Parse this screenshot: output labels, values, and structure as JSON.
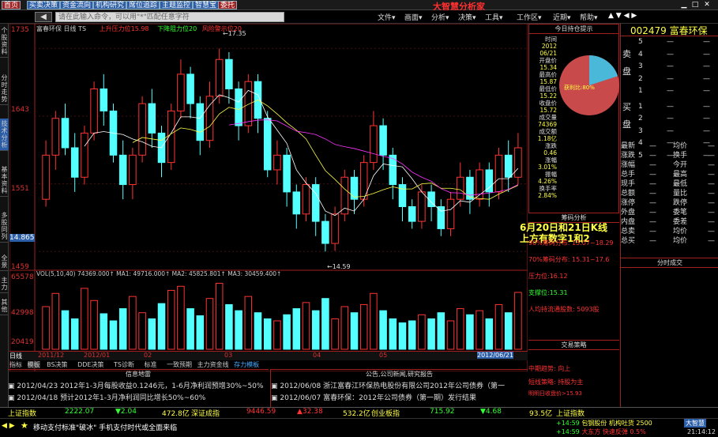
{
  "toolbar": {
    "buttons": [
      {
        "label": "首页"
      },
      {
        "label": "买卖决策"
      },
      {
        "label": "资金流向"
      },
      {
        "label": "机构研究"
      },
      {
        "label": "席位追踪"
      },
      {
        "label": "主题监控"
      },
      {
        "label": "智慧宝"
      },
      {
        "label": "委托"
      }
    ],
    "app_title": "大智慧分析家"
  },
  "menubar": {
    "command_placeholder": "请在此输入命令，可以用\"*\"匹配任意字符",
    "items": [
      "文件▾",
      "画面▾",
      "分析▾",
      "决策▾",
      "工具▾",
      "工作区▾",
      "近期▾",
      "帮助▾"
    ]
  },
  "left_tabs": [
    "个股资料",
    "分时走势",
    "技术分析",
    "基本资料",
    "多股同列",
    "全景",
    "主力",
    "其他"
  ],
  "chart": {
    "stock_label": "富春环保 日线 TS",
    "legend_up": "上升压力位15.98",
    "legend_down": "下降阻力位20",
    "legend_risk": "风险警示位20",
    "y_ticks": [
      "1735",
      "1643",
      "1551",
      "14.865",
      "1459"
    ],
    "high_mark": "17.35",
    "low_mark": "14.59",
    "annotation_line1": "6月20日和21日K线",
    "annotation_line2": "上方有数字1和2",
    "candles": [
      {
        "o": 15.3,
        "c": 15.9,
        "h": 16.1,
        "l": 15.2
      },
      {
        "o": 15.9,
        "c": 16.4,
        "h": 16.5,
        "l": 15.7
      },
      {
        "o": 16.4,
        "c": 16.0,
        "h": 16.6,
        "l": 15.9
      },
      {
        "o": 16.0,
        "c": 15.6,
        "h": 16.2,
        "l": 15.4
      },
      {
        "o": 15.6,
        "c": 16.2,
        "h": 16.3,
        "l": 15.5
      },
      {
        "o": 16.2,
        "c": 16.8,
        "h": 16.9,
        "l": 16.1
      },
      {
        "o": 16.8,
        "c": 16.5,
        "h": 17.0,
        "l": 16.3
      },
      {
        "o": 16.5,
        "c": 15.9,
        "h": 16.6,
        "l": 15.8
      },
      {
        "o": 15.9,
        "c": 15.5,
        "h": 16.1,
        "l": 15.3
      },
      {
        "o": 15.5,
        "c": 15.9,
        "h": 16.0,
        "l": 15.3
      },
      {
        "o": 15.9,
        "c": 16.6,
        "h": 16.7,
        "l": 15.8
      },
      {
        "o": 16.6,
        "c": 16.2,
        "h": 16.8,
        "l": 16.0
      },
      {
        "o": 16.2,
        "c": 15.8,
        "h": 16.3,
        "l": 15.6
      },
      {
        "o": 15.8,
        "c": 16.5,
        "h": 16.6,
        "l": 15.7
      },
      {
        "o": 16.5,
        "c": 17.0,
        "h": 17.2,
        "l": 16.4
      },
      {
        "o": 17.0,
        "c": 16.6,
        "h": 17.1,
        "l": 16.4
      },
      {
        "o": 16.6,
        "c": 16.1,
        "h": 16.7,
        "l": 15.9
      },
      {
        "o": 16.1,
        "c": 16.7,
        "h": 16.9,
        "l": 16.0
      },
      {
        "o": 16.7,
        "c": 17.2,
        "h": 17.35,
        "l": 16.6
      },
      {
        "o": 17.2,
        "c": 16.8,
        "h": 17.3,
        "l": 16.6
      },
      {
        "o": 16.8,
        "c": 16.3,
        "h": 16.9,
        "l": 16.1
      },
      {
        "o": 16.3,
        "c": 16.9,
        "h": 17.0,
        "l": 16.2
      },
      {
        "o": 16.9,
        "c": 16.4,
        "h": 17.0,
        "l": 16.2
      },
      {
        "o": 16.4,
        "c": 15.7,
        "h": 16.5,
        "l": 15.6
      },
      {
        "o": 15.7,
        "c": 15.9,
        "h": 16.1,
        "l": 15.5
      },
      {
        "o": 15.9,
        "c": 15.4,
        "h": 16.0,
        "l": 15.2
      },
      {
        "o": 15.4,
        "c": 15.1,
        "h": 15.5,
        "l": 14.9
      },
      {
        "o": 15.1,
        "c": 15.5,
        "h": 15.6,
        "l": 15.0
      },
      {
        "o": 15.5,
        "c": 15.0,
        "h": 15.6,
        "l": 14.8
      },
      {
        "o": 15.0,
        "c": 14.7,
        "h": 15.1,
        "l": 14.59
      },
      {
        "o": 14.7,
        "c": 15.1,
        "h": 15.2,
        "l": 14.6
      },
      {
        "o": 15.1,
        "c": 15.6,
        "h": 15.7,
        "l": 15.0
      },
      {
        "o": 15.6,
        "c": 15.3,
        "h": 15.7,
        "l": 15.1
      },
      {
        "o": 15.3,
        "c": 15.8,
        "h": 15.9,
        "l": 15.2
      },
      {
        "o": 15.8,
        "c": 16.3,
        "h": 16.5,
        "l": 15.7
      },
      {
        "o": 16.3,
        "c": 15.9,
        "h": 16.4,
        "l": 15.7
      },
      {
        "o": 15.9,
        "c": 15.5,
        "h": 16.0,
        "l": 15.3
      },
      {
        "o": 15.5,
        "c": 15.2,
        "h": 15.6,
        "l": 15.0
      },
      {
        "o": 15.2,
        "c": 15.0,
        "h": 15.3,
        "l": 14.9
      },
      {
        "o": 15.0,
        "c": 15.4,
        "h": 15.5,
        "l": 14.9
      },
      {
        "o": 15.4,
        "c": 15.2,
        "h": 15.5,
        "l": 15.0
      },
      {
        "o": 15.2,
        "c": 14.9,
        "h": 15.3,
        "l": 14.8
      },
      {
        "o": 14.9,
        "c": 15.3,
        "h": 15.4,
        "l": 14.8
      },
      {
        "o": 15.3,
        "c": 15.6,
        "h": 15.8,
        "l": 15.2
      },
      {
        "o": 15.6,
        "c": 15.3,
        "h": 15.7,
        "l": 15.1
      },
      {
        "o": 15.3,
        "c": 15.7,
        "h": 15.8,
        "l": 15.2
      },
      {
        "o": 15.7,
        "c": 15.4,
        "h": 15.8,
        "l": 15.2
      },
      {
        "o": 15.4,
        "c": 15.9,
        "h": 16.0,
        "l": 15.3
      },
      {
        "o": 15.9,
        "c": 15.6,
        "h": 16.1,
        "l": 15.4
      },
      {
        "o": 15.6,
        "c": 16.0,
        "h": 16.2,
        "l": 15.5
      }
    ]
  },
  "volume": {
    "legend": "VOL(5,10,40) 74369.000↑ MA1: 49716.000↑ MA2: 45825.801↑ MA3: 30459.400↑",
    "y_ticks": [
      "65578",
      "42998",
      "20419"
    ],
    "bars": [
      42,
      55,
      38,
      30,
      60,
      48,
      35,
      28,
      40,
      52,
      36,
      30,
      45,
      58,
      62,
      40,
      33,
      50,
      65,
      44,
      38,
      52,
      36,
      30,
      28,
      34,
      40,
      46,
      38,
      50,
      30,
      42,
      36,
      44,
      55,
      38,
      30,
      26,
      28,
      34,
      30,
      36,
      28,
      40,
      34,
      38,
      30,
      44,
      36,
      56
    ]
  },
  "date_axis": {
    "period_label": "日线",
    "ticks": [
      "2011/12",
      "2012/01",
      "02",
      "03",
      "04",
      "05",
      "2012/06/21"
    ]
  },
  "bottom_tabs": [
    "指标",
    "模板",
    "BS决策",
    "DDE决策",
    "TS诊断",
    "标准",
    "一致预期",
    "主力资金线",
    "存力模板"
  ],
  "news_left": {
    "title": "信息地雷",
    "items": [
      "2012/04/23 2012年1-3月每股收益0.1246元，1-6月净利润预增30%~50%",
      "2012/04/18 预计2012年1-3月净利润同比增长50%~60%"
    ]
  },
  "news_right": {
    "title": "公告,公司新闻,研究报告",
    "items": [
      "2012/06/08 浙江富春江环保热电股份有限公司2012年公司债券（第一",
      "2012/06/07 富春环保：2012年公司债券（第一期）发行结果"
    ]
  },
  "info_panel": {
    "title": "今日持仓提示",
    "rows": [
      {
        "label": "时间",
        "value": "2012 06/21"
      },
      {
        "label": "开盘价",
        "value": "15.34"
      },
      {
        "label": "最高价",
        "value": "15.87"
      },
      {
        "label": "最低价",
        "value": "15.22"
      },
      {
        "label": "收盘价",
        "value": "15.72"
      },
      {
        "label": "成交量",
        "value": "74369"
      },
      {
        "label": "成交额",
        "value": "1.18亿"
      },
      {
        "label": "涨跌",
        "value": "0.46"
      },
      {
        "label": "涨幅",
        "value": "3.01%"
      },
      {
        "label": "振幅",
        "value": "4.26%"
      },
      {
        "label": "换手率",
        "value": "2.84%"
      }
    ],
    "pie_label": "获利比:80%",
    "pie_fraction": 0.2
  },
  "chip_panel": {
    "title": "筹码分析",
    "lines": [
      "90%筹码分布: 15.07~18.29",
      "70%筹码分布: 15.31~17.6",
      "压力位:16.12",
      "支撑位:15.31",
      "人均持流通股数: 5093股"
    ]
  },
  "strategy_panel": {
    "title": "交易策略",
    "lines": [
      "中期趋势: 向上",
      "短线策略: 持股为主",
      "明明日收盘价>15.93"
    ]
  },
  "quote": {
    "code": "002479",
    "name": "富春环保",
    "sell_label": "卖盘",
    "buy_label": "买盘",
    "levels": [
      "5",
      "4",
      "3",
      "2",
      "1",
      "1",
      "2",
      "3",
      "4",
      "5"
    ],
    "fields": [
      {
        "l": "最新",
        "r": "均价"
      },
      {
        "l": "涨跌",
        "r": "换手"
      },
      {
        "l": "涨幅",
        "r": "今开"
      },
      {
        "l": "总手",
        "r": "最高"
      },
      {
        "l": "现手",
        "r": "最低"
      },
      {
        "l": "总额",
        "r": "量比"
      },
      {
        "l": "涨停",
        "r": "跌停"
      },
      {
        "l": "外盘",
        "r": "委笔"
      },
      {
        "l": "内盘",
        "r": "委差"
      },
      {
        "l": "总卖",
        "r": "均价"
      },
      {
        "l": "总买",
        "r": "均价"
      }
    ],
    "tick_title": "分时成交"
  },
  "ticker": {
    "items": [
      {
        "name": "上证指数",
        "price": "2222.07",
        "change": "▼2.04",
        "amount": "472.8亿"
      },
      {
        "name": "深证成指",
        "price": "9446.59",
        "change": "▲32.38",
        "amount": "532.2亿"
      },
      {
        "name": "创业板指",
        "price": "715.92",
        "change": "▼4.68",
        "amount": "93.5亿"
      }
    ],
    "right_index": "上证指数"
  },
  "status": {
    "message": "移动支付标准\"破冰\" 手机支付时代或全面来临",
    "stock1": "包钢股份 机构吐货 2500",
    "stock2": "大东方 快速反弹 0.5%",
    "time1": "14:59",
    "time2": "14:59",
    "clock": "21:14:12",
    "brand": "大智慧"
  },
  "colors": {
    "up": "#ff3333",
    "down": "#54ffff",
    "panel_border": "#a02020"
  }
}
